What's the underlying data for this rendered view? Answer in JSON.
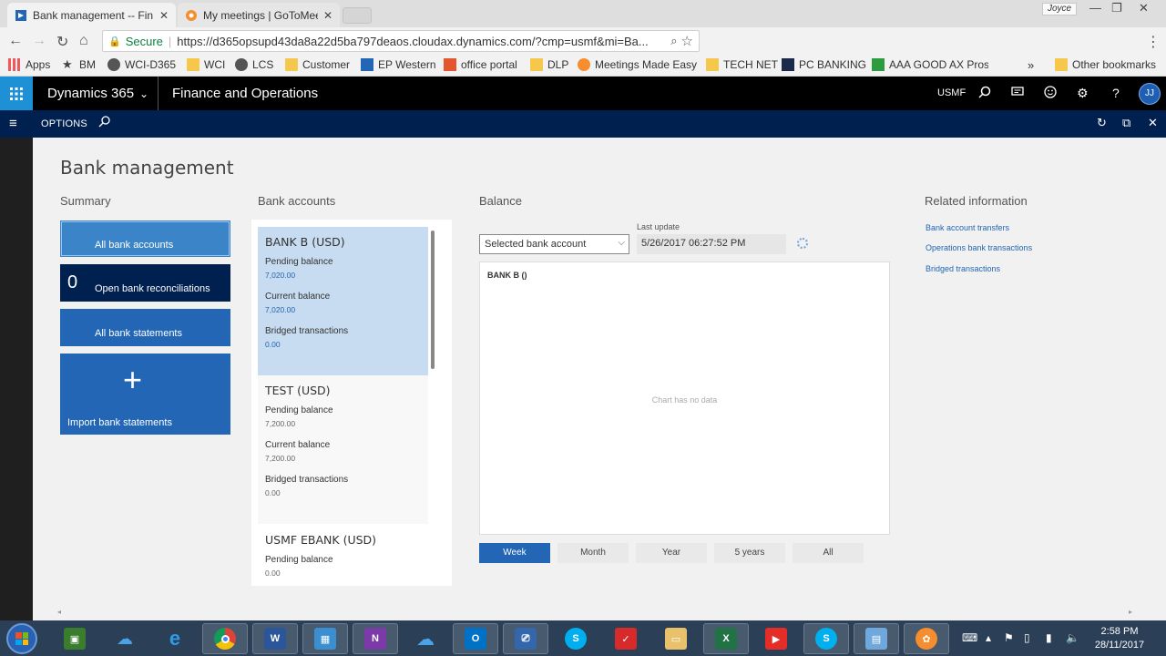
{
  "browser": {
    "tabs": [
      {
        "title": "Bank management -- Fin",
        "active": true
      },
      {
        "title": "My meetings | GoToMee",
        "active": false
      }
    ],
    "profile": "Joyce",
    "secure_label": "Secure",
    "url": "https://d365opsupd43da8a22d5ba797deaos.cloudax.dynamics.com/?cmp=usmf&mi=Ba...",
    "bookmarks": [
      {
        "label": "Apps",
        "icon": "apps-icon"
      },
      {
        "label": "BM",
        "icon": "star-icon"
      },
      {
        "label": "WCI-D365",
        "icon": "site-icon"
      },
      {
        "label": "WCI",
        "icon": "folder-icon"
      },
      {
        "label": "LCS",
        "icon": "site-icon"
      },
      {
        "label": "Customer",
        "icon": "folder-icon"
      },
      {
        "label": "EP Western",
        "icon": "chart-icon"
      },
      {
        "label": "office portal",
        "icon": "office-icon"
      },
      {
        "label": "DLP",
        "icon": "folder-icon"
      },
      {
        "label": "Meetings Made Easy",
        "icon": "gotomeeting-icon"
      },
      {
        "label": "TECH NET",
        "icon": "folder-icon"
      },
      {
        "label": "PC BANKING",
        "icon": "site-icon"
      },
      {
        "label": "AAA GOOD AX Pros",
        "icon": "sheet-icon"
      }
    ],
    "more_bookmarks": "»",
    "other_bookmarks": "Other bookmarks"
  },
  "d365": {
    "product": "Dynamics 365",
    "module": "Finance and Operations",
    "company": "USMF",
    "user_initials": "JJ",
    "options_label": "OPTIONS"
  },
  "workspace": {
    "title": "Bank management",
    "summary": {
      "title": "Summary",
      "tiles": [
        {
          "label": "All bank accounts"
        },
        {
          "count": "0",
          "label": "Open bank reconciliations"
        },
        {
          "label": "All bank statements"
        },
        {
          "label": "Import bank statements"
        }
      ]
    },
    "accounts": {
      "title": "Bank accounts",
      "items": [
        {
          "name": "BANK B (USD)",
          "f1": "Pending balance",
          "v1": "7,020.00",
          "f2": "Current balance",
          "v2": "7,020.00",
          "f3": "Bridged transactions",
          "v3": "0.00"
        },
        {
          "name": "TEST (USD)",
          "f1": "Pending balance",
          "v1": "7,200.00",
          "f2": "Current balance",
          "v2": "7,200.00",
          "f3": "Bridged transactions",
          "v3": "0.00"
        },
        {
          "name": "USMF EBANK (USD)",
          "f1": "Pending balance",
          "v1": "0.00"
        }
      ]
    },
    "balance": {
      "title": "Balance",
      "selector_value": "Selected bank account",
      "last_update_label": "Last update",
      "last_update_value": "5/26/2017 06:27:52 PM",
      "chart_title": "BANK B ()",
      "no_data": "Chart has no data",
      "ranges": [
        "Week",
        "Month",
        "Year",
        "5 years",
        "All"
      ],
      "active_range": "Week"
    },
    "related": {
      "title": "Related information",
      "links": [
        "Bank account transfers",
        "Operations bank transactions",
        "Bridged transactions"
      ]
    }
  },
  "taskbar": {
    "time": "2:58 PM",
    "date": "28/11/2017"
  }
}
